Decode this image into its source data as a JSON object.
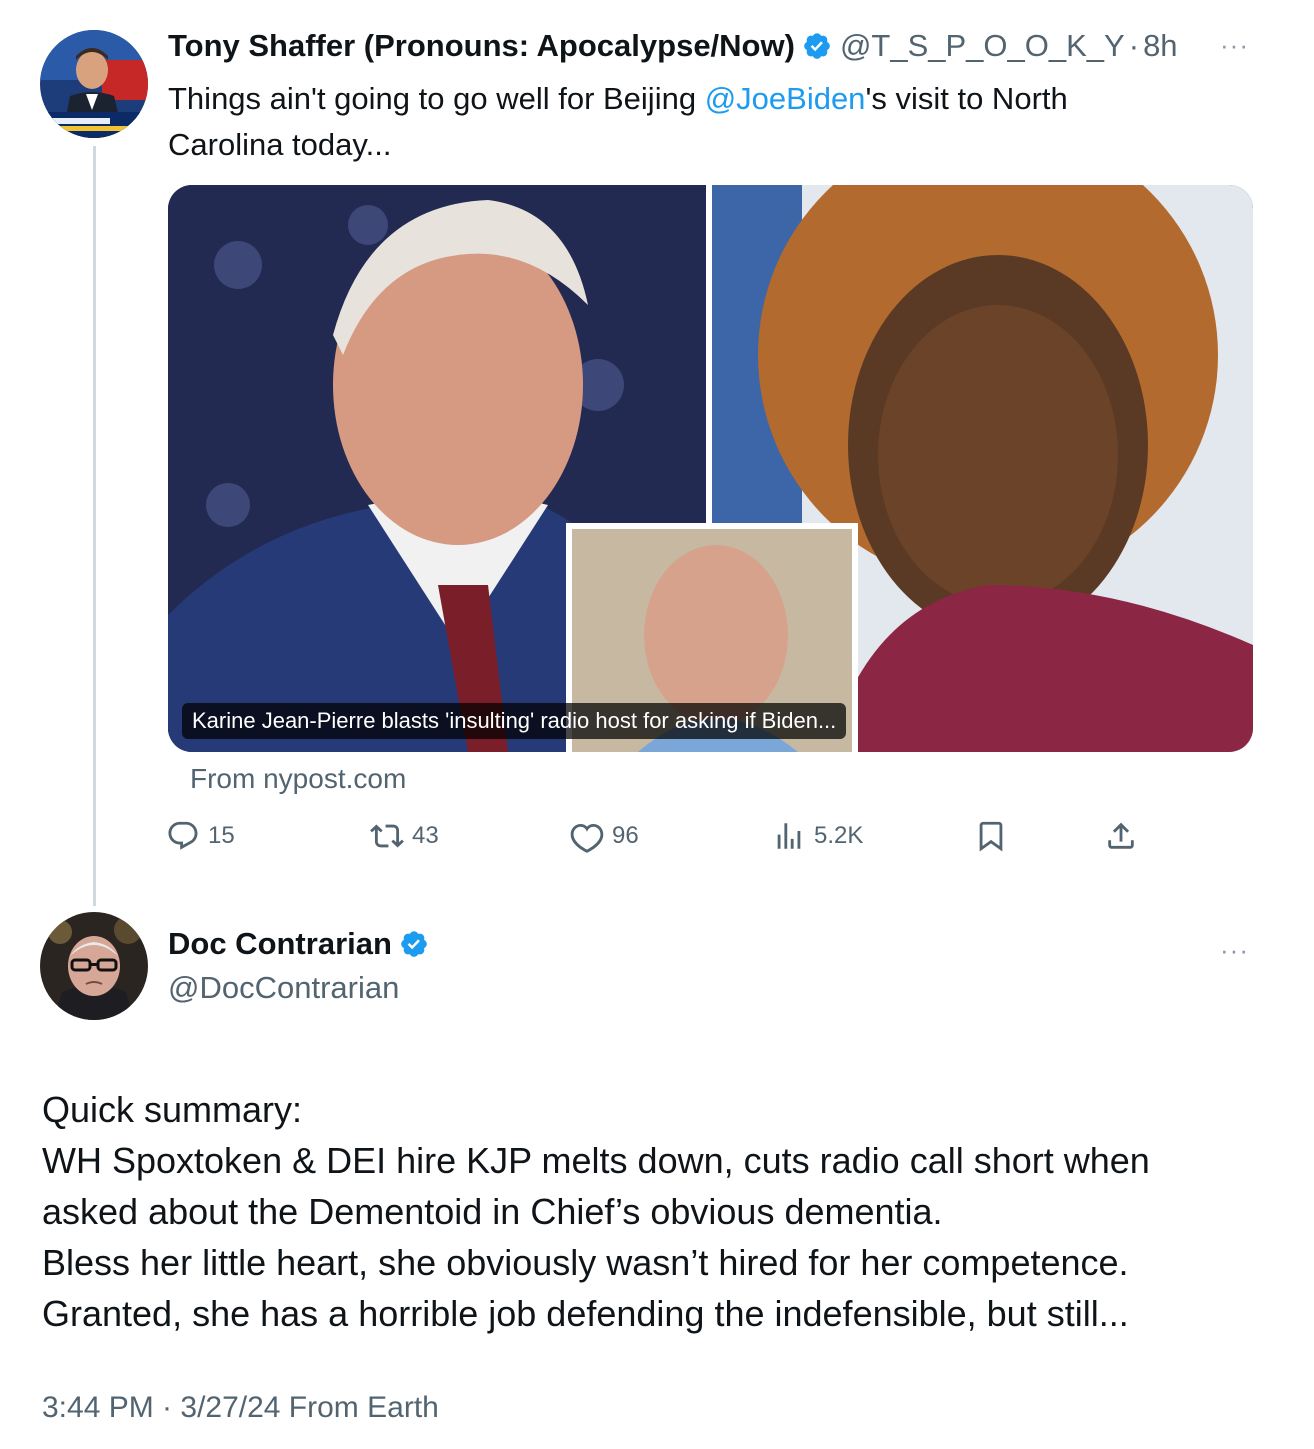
{
  "parent_tweet": {
    "author_name": "Tony Shaffer (Pronouns: Apocalypse/Now)",
    "handle": "@T_S_P_O_O_K_Y",
    "separator": "·",
    "time": "8h",
    "text_before_mention": "Things ain't going to go well for Beijing ",
    "mention": "@JoeBiden",
    "text_after_mention_line1": "'s visit to North",
    "text_line2": "Carolina today...",
    "link_card": {
      "caption": "Karine Jean-Pierre blasts 'insulting' radio host for asking if Biden...",
      "source": "From nypost.com"
    },
    "actions": {
      "replies": "15",
      "reposts": "43",
      "likes": "96",
      "views": "5.2K"
    }
  },
  "reply_tweet": {
    "author_name": "Doc Contrarian",
    "handle": "@DocContrarian",
    "body_lines": [
      "Quick summary:",
      "WH Spoxtoken & DEI hire KJP melts down, cuts radio call short when",
      "asked about the Dementoid in Chief’s obvious dementia.",
      "Bless her little heart, she obviously wasn’t hired for her competence.",
      "Granted, she has a horrible job defending the indefensible, but still..."
    ],
    "timestamp": "3:44 PM · 3/27/24 From Earth"
  },
  "ui": {
    "more_glyph": "···"
  },
  "colors": {
    "link_blue": "#1d9bf0",
    "verified_blue": "#1d9bf0",
    "secondary_text": "#536471",
    "primary_text": "#0f1419",
    "thread_line": "#cfd9de"
  },
  "icons": {
    "reply": "reply-icon",
    "repost": "repost-icon",
    "like": "like-icon",
    "views": "views-icon",
    "bookmark": "bookmark-icon",
    "share": "share-icon",
    "verified": "verified-badge-icon",
    "more": "more-icon"
  }
}
